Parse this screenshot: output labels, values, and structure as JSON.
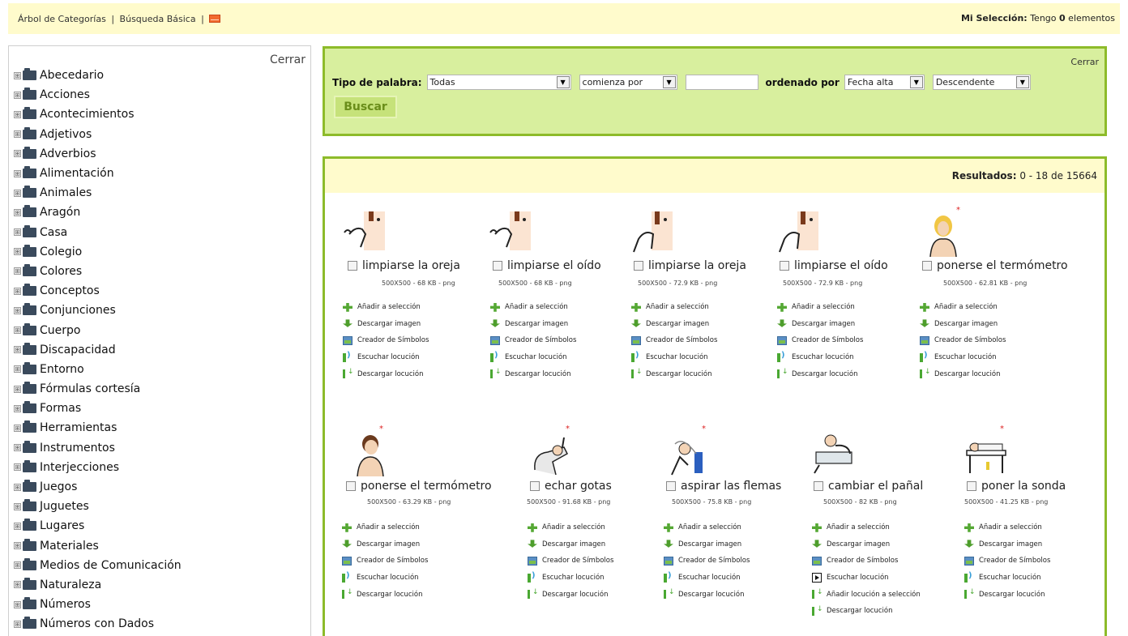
{
  "topbar": {
    "links": [
      "Árbol de Categorías",
      "Búsqueda Básica"
    ],
    "separator": "|",
    "selection_label": "Mi Selección:",
    "selection_text_pre": "Tengo",
    "selection_count": "0",
    "selection_text_post": "elementos"
  },
  "sidebar": {
    "close_label": "Cerrar",
    "expand_glyph": "⊞",
    "categories": [
      "Abecedario",
      "Acciones",
      "Acontecimientos",
      "Adjetivos",
      "Adverbios",
      "Alimentación",
      "Animales",
      "Aragón",
      "Casa",
      "Colegio",
      "Colores",
      "Conceptos",
      "Conjunciones",
      "Cuerpo",
      "Discapacidad",
      "Entorno",
      "Fórmulas cortesía",
      "Formas",
      "Herramientas",
      "Instrumentos",
      "Interjecciones",
      "Juegos",
      "Juguetes",
      "Lugares",
      "Materiales",
      "Medios de Comunicación",
      "Naturaleza",
      "Números",
      "Números con Dados"
    ]
  },
  "search": {
    "close_label": "Cerrar",
    "word_type_label": "Tipo de palabra:",
    "word_type_value": "Todas",
    "match_value": "comienza por",
    "search_text": "",
    "order_label": "ordenado por",
    "order_by_value": "Fecha alta",
    "direction_value": "Descendente",
    "button_label": "Buscar",
    "dropdown_glyph": "▼"
  },
  "results": {
    "label": "Resultados:",
    "range": "0 - 18 de 15664",
    "new_marker": "*",
    "actions": {
      "add": "Añadir a selección",
      "download_image": "Descargar imagen",
      "symbol_creator": "Creador de Símbolos",
      "listen": "Escuchar locución",
      "add_audio": "Añadir locución a selección",
      "download_audio": "Descargar locución"
    },
    "items": [
      {
        "name": "limpiarse la oreja",
        "meta": "500X500 - 68 KB - png"
      },
      {
        "name": "limpiarse el oído",
        "meta": "500X500 - 68 KB - png"
      },
      {
        "name": "limpiarse la oreja",
        "meta": "500X500 - 72.9 KB - png"
      },
      {
        "name": "limpiarse el oído",
        "meta": "500X500 - 72.9 KB - png"
      },
      {
        "name": "ponerse el termómetro",
        "meta": "500X500 - 62.81 KB - png"
      },
      {
        "name": "ponerse el termómetro",
        "meta": "500X500 - 63.29 KB - png"
      },
      {
        "name": "echar gotas",
        "meta": "500X500 - 91.68 KB - png"
      },
      {
        "name": "aspirar las flemas",
        "meta": "500X500 - 75.8 KB - png"
      },
      {
        "name": "cambiar el pañal",
        "meta": "500X500 - 82 KB - png"
      },
      {
        "name": "poner la sonda",
        "meta": "500X500 - 41.25 KB - png"
      }
    ]
  },
  "colors": {
    "accent_green": "#8dbb2a",
    "panel_green": "#d8ef9e",
    "header_yellow": "#fffbcc"
  }
}
